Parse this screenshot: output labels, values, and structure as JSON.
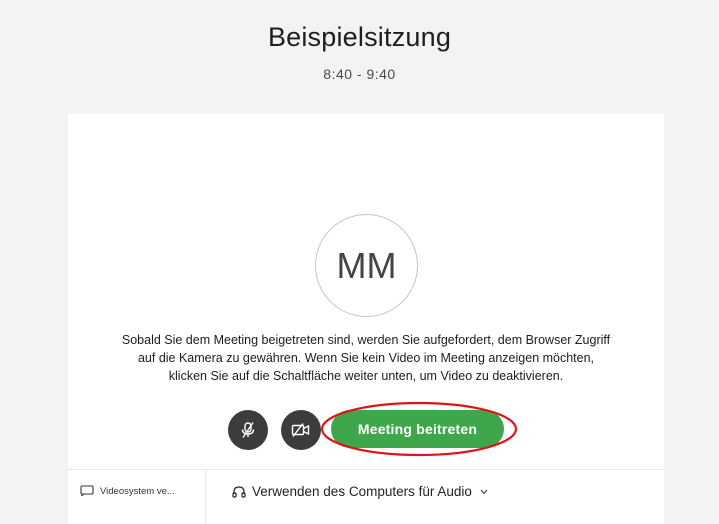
{
  "meeting": {
    "title": "Beispielsitzung",
    "time": "8:40 - 9:40"
  },
  "preview": {
    "avatar_initials": "MM",
    "info_text": "Sobald Sie dem Meeting beigetreten sind, werden Sie aufgefordert, dem Browser Zugriff auf die Kamera zu gewähren. Wenn Sie kein Video im Meeting anzeigen möchten, klicken Sie auf die Schaltfläche weiter unten, um Video zu deaktivieren."
  },
  "controls": {
    "mute_icon": "microphone-muted-icon",
    "video_icon": "video-off-icon",
    "join_label": "Meeting beitreten",
    "join_color": "#3fa74b",
    "highlight_color": "#e01414"
  },
  "footer": {
    "video_system_label": "Videosystem ve...",
    "video_system_icon": "cast-screen-icon",
    "audio_label": "Verwenden des Computers für Audio",
    "audio_icon": "headset-icon",
    "audio_dropdown_icon": "chevron-down-icon"
  }
}
